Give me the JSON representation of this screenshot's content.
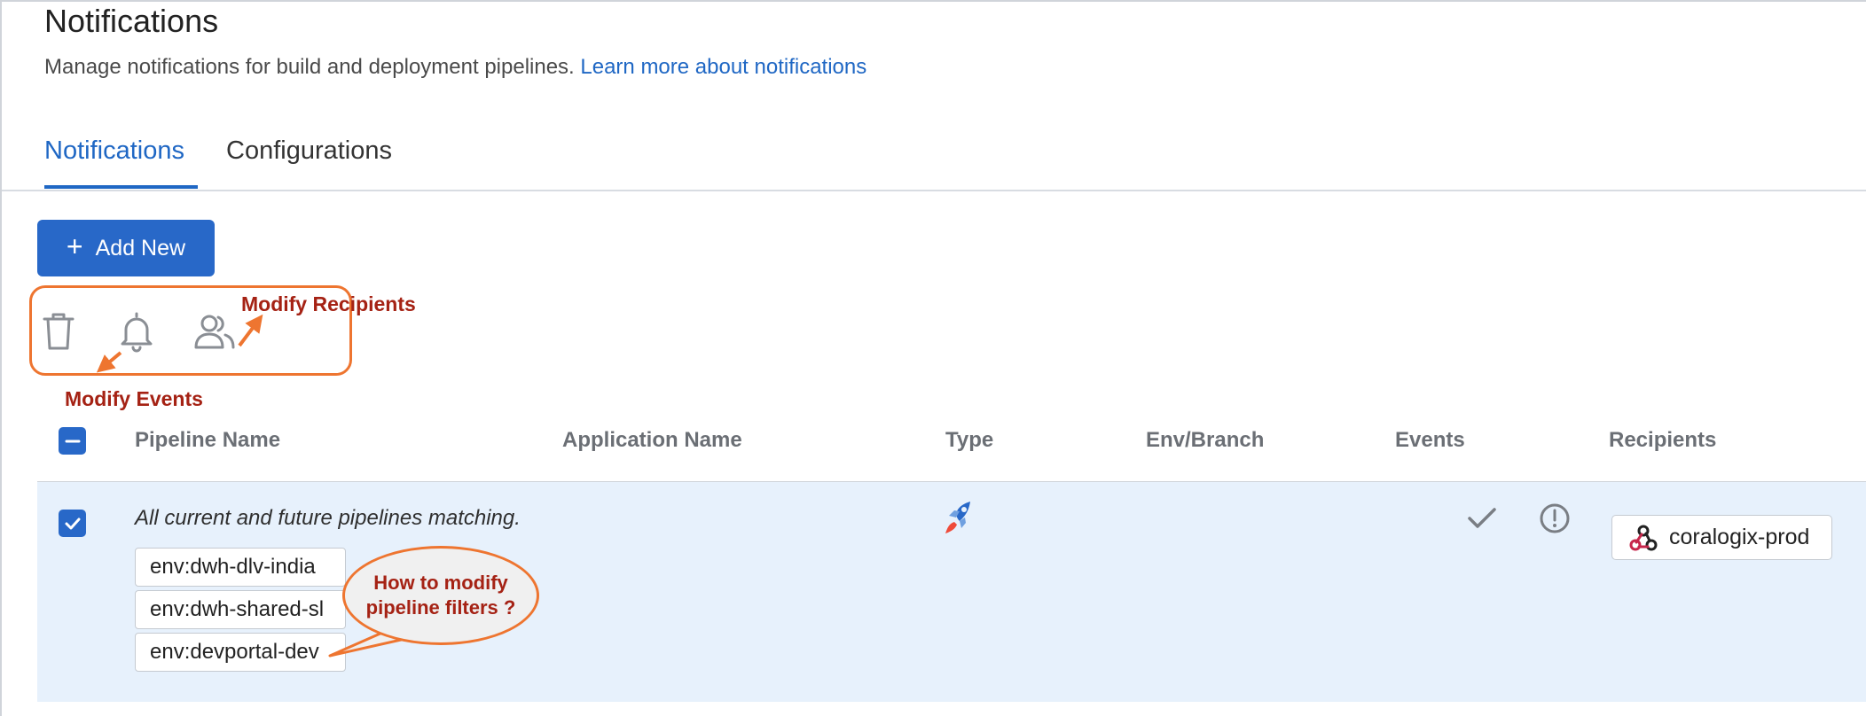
{
  "header": {
    "title": "Notifications",
    "subtitle": "Manage notifications for build and deployment pipelines.",
    "learn_more": "Learn more about notifications"
  },
  "tabs": [
    {
      "label": "Notifications",
      "active": true
    },
    {
      "label": "Configurations",
      "active": false
    }
  ],
  "toolbar": {
    "add_new_label": "Add New",
    "icons": [
      "trash-icon",
      "bell-icon",
      "users-icon"
    ]
  },
  "annotations": {
    "modify_recipients": "Modify Recipients",
    "modify_events": "Modify Events",
    "bubble_line1": "How to modify",
    "bubble_line2": "pipeline filters ?"
  },
  "table": {
    "columns": [
      "Pipeline Name",
      "Application Name",
      "Type",
      "Env/Branch",
      "Events",
      "Recipients"
    ],
    "rows": [
      {
        "selected": true,
        "description": "All current and future pipelines matching.",
        "filters": [
          "env:dwh-dlv-india",
          "env:dwh-shared-sl",
          "env:devportal-dev"
        ],
        "type_icon": "rocket-icon",
        "event_icons": [
          "check-icon",
          "alert-circle-icon"
        ],
        "recipient": "coralogix-prod",
        "recipient_icon": "webhook-icon"
      }
    ]
  },
  "colors": {
    "accent": "#2868c8",
    "link": "#1f67c4",
    "annotation_orange": "#ee7530",
    "annotation_text": "#a52214",
    "row_selected_bg": "#e7f1fc"
  }
}
